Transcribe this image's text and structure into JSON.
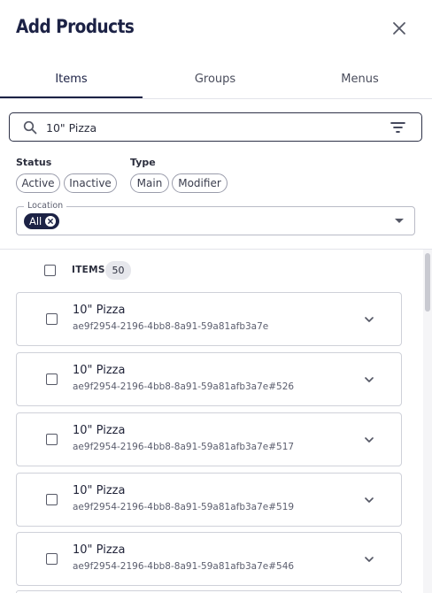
{
  "header": {
    "title": "Add Products",
    "close_icon": "close-icon"
  },
  "tabs": [
    {
      "label": "Items",
      "active": true
    },
    {
      "label": "Groups",
      "active": false
    },
    {
      "label": "Menus",
      "active": false
    }
  ],
  "search": {
    "value": "10\" Pizza",
    "icon": "search-icon",
    "filter_icon": "filter-icon"
  },
  "filters": {
    "status": {
      "label": "Status",
      "options": [
        "Active",
        "Inactive"
      ]
    },
    "type": {
      "label": "Type",
      "options": [
        "Main",
        "Modifier"
      ]
    }
  },
  "location": {
    "label": "Location",
    "selected": "All"
  },
  "items_list": {
    "header_label": "ITEMS",
    "count": "50",
    "items": [
      {
        "name": "10\" Pizza",
        "id": "ae9f2954-2196-4bb8-8a91-59a81afb3a7e"
      },
      {
        "name": "10\" Pizza",
        "id": "ae9f2954-2196-4bb8-8a91-59a81afb3a7e#526"
      },
      {
        "name": "10\" Pizza",
        "id": "ae9f2954-2196-4bb8-8a91-59a81afb3a7e#517"
      },
      {
        "name": "10\" Pizza",
        "id": "ae9f2954-2196-4bb8-8a91-59a81afb3a7e#519"
      },
      {
        "name": "10\" Pizza",
        "id": "ae9f2954-2196-4bb8-8a91-59a81afb3a7e#546"
      }
    ]
  },
  "colors": {
    "brand": "#1c2245",
    "border": "#cfd1d9"
  }
}
